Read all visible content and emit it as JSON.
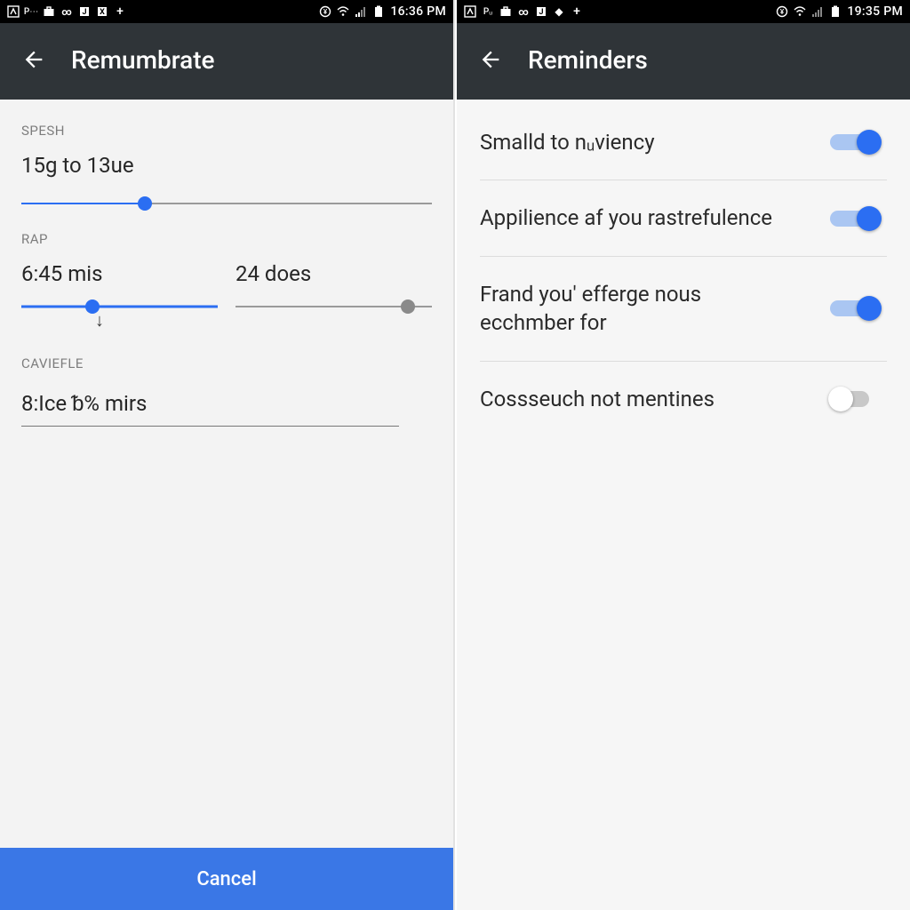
{
  "left": {
    "status": {
      "time": "16:36 PM"
    },
    "title": "Remumbrate",
    "spesh": {
      "label": "SPESH",
      "value": "15g to 13ue",
      "slider_pct": 30
    },
    "rap": {
      "label": "RAP",
      "left": {
        "value": "6:45 mis",
        "slider_pct": 36
      },
      "right": {
        "value": "24 does",
        "slider_pct": 88
      }
    },
    "caviefle": {
      "label": "CAVIEFLE",
      "value": "8:Ice ᵬ% mirs"
    },
    "cancel": "Cancel"
  },
  "right": {
    "status": {
      "time": "19:35 PM"
    },
    "title": "Reminders",
    "items": [
      {
        "label": "Smalld to nᵤviency",
        "on": true
      },
      {
        "label": "Appilience af you rastrefulence",
        "on": true
      },
      {
        "label": "Frand you' efferge nous ecchmber for",
        "on": true
      },
      {
        "label": "Cossseuch not mentines",
        "on": false
      }
    ]
  }
}
